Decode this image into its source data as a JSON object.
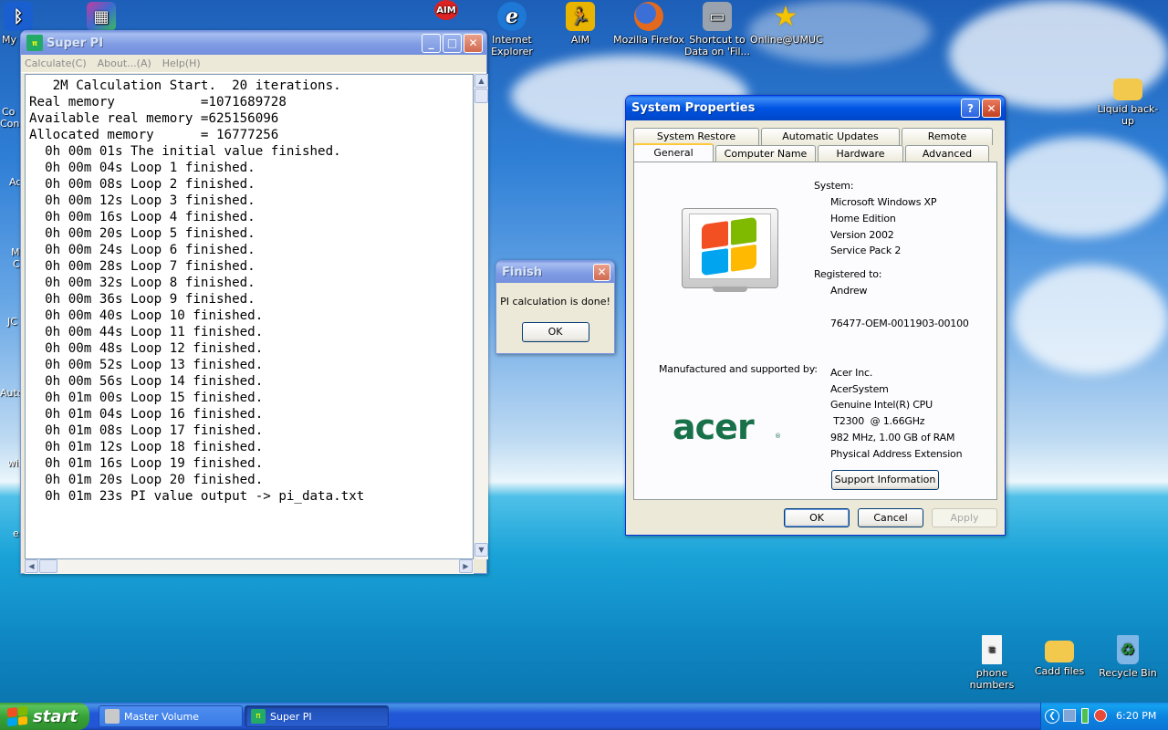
{
  "desktop": {
    "icons": [
      {
        "id": "bluetooth",
        "label": "My",
        "color": "#1a5fd0"
      },
      {
        "id": "winrar",
        "label": "",
        "color": "#c43ba0"
      },
      {
        "id": "aim-top",
        "label": "",
        "color": "#d22"
      },
      {
        "id": "ie",
        "label": "Internet Explorer",
        "color": "#1e78d6"
      },
      {
        "id": "aim",
        "label": "AIM",
        "color": "#e9b400"
      },
      {
        "id": "firefox",
        "label": "Mozilla Firefox",
        "color": "#e36a1c"
      },
      {
        "id": "shortcut",
        "label": "Shortcut to Data on 'Fil...",
        "color": "#9aa3ad"
      },
      {
        "id": "umuc",
        "label": "Online@UMUC",
        "color": "#f5c400"
      },
      {
        "id": "liquid",
        "label": "Liquid back-up",
        "color": "#f2c94c"
      },
      {
        "id": "phone",
        "label": "phone numbers",
        "color": "#f5f5f5"
      },
      {
        "id": "cadd",
        "label": "Cadd files",
        "color": "#f2c94c"
      },
      {
        "id": "recycle",
        "label": "Recycle Bin",
        "color": "#7fb6e6"
      }
    ],
    "left_partial": [
      "Co",
      "Con",
      "Ac",
      "M",
      "C",
      "JC",
      "Auto",
      "wif",
      "e"
    ]
  },
  "superpi": {
    "title": "Super PI",
    "menu": [
      "Calculate(C)",
      "About...(A)",
      "Help(H)"
    ],
    "lines": [
      "   2M Calculation Start.  20 iterations.",
      "Real memory           =1071689728",
      "Available real memory =625156096",
      "Allocated memory      = 16777256",
      "  0h 00m 01s The initial value finished.",
      "  0h 00m 04s Loop 1 finished.",
      "  0h 00m 08s Loop 2 finished.",
      "  0h 00m 12s Loop 3 finished.",
      "  0h 00m 16s Loop 4 finished.",
      "  0h 00m 20s Loop 5 finished.",
      "  0h 00m 24s Loop 6 finished.",
      "  0h 00m 28s Loop 7 finished.",
      "  0h 00m 32s Loop 8 finished.",
      "  0h 00m 36s Loop 9 finished.",
      "  0h 00m 40s Loop 10 finished.",
      "  0h 00m 44s Loop 11 finished.",
      "  0h 00m 48s Loop 12 finished.",
      "  0h 00m 52s Loop 13 finished.",
      "  0h 00m 56s Loop 14 finished.",
      "  0h 01m 00s Loop 15 finished.",
      "  0h 01m 04s Loop 16 finished.",
      "  0h 01m 08s Loop 17 finished.",
      "  0h 01m 12s Loop 18 finished.",
      "  0h 01m 16s Loop 19 finished.",
      "  0h 01m 20s Loop 20 finished.",
      "  0h 01m 23s PI value output -> pi_data.txt"
    ]
  },
  "finish_dialog": {
    "title": "Finish",
    "message": "PI calculation is done!",
    "ok_label": "OK"
  },
  "sysprop": {
    "title": "System Properties",
    "tabs_top": [
      "System Restore",
      "Automatic Updates",
      "Remote"
    ],
    "tabs_bottom": [
      "General",
      "Computer Name",
      "Hardware",
      "Advanced"
    ],
    "system_label": "System:",
    "system_lines": [
      "Microsoft Windows XP",
      "Home Edition",
      "Version 2002",
      "Service Pack 2"
    ],
    "registered_label": "Registered to:",
    "registered_name": "Andrew",
    "product_id": "76477-OEM-0011903-00100",
    "manufactured_label": "Manufactured and supported by:",
    "manufacturer_lines": [
      "Acer Inc.",
      "AcerSystem",
      "Genuine Intel(R) CPU",
      " T2300  @ 1.66GHz",
      "982 MHz, 1.00 GB of RAM",
      "Physical Address Extension"
    ],
    "support_button": "Support Information",
    "logo_text": "acer",
    "ok_label": "OK",
    "cancel_label": "Cancel",
    "apply_label": "Apply"
  },
  "taskbar": {
    "start_label": "start",
    "tasks": [
      "Master Volume",
      "Super PI"
    ],
    "clock": "6:20 PM"
  }
}
